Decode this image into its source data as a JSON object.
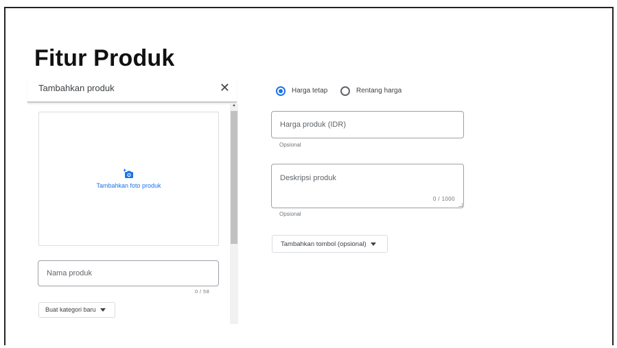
{
  "page": {
    "title": "Fitur Produk"
  },
  "left_panel": {
    "header_title": "Tambahkan produk",
    "close_glyph": "✕",
    "photo_label": "Tambahkan foto produk",
    "photo_icon": "add-photo-icon",
    "name_field": {
      "label": "Nama produk",
      "counter": "0 / 58"
    },
    "category_button": "Buat kategori baru"
  },
  "right_panel": {
    "radio_options": [
      {
        "label": "Harga tetap",
        "selected": true
      },
      {
        "label": "Rentang harga",
        "selected": false
      }
    ],
    "price_field": {
      "label": "Harga produk (IDR)",
      "helper": "Opsional"
    },
    "description_field": {
      "label": "Deskripsi produk",
      "counter": "0 / 1000",
      "helper": "Opsional"
    },
    "add_button": "Tambahkan tombol (opsional)"
  },
  "colors": {
    "accent": "#1a73e8",
    "border": "#9aa0a6",
    "text": "#3c4043"
  }
}
